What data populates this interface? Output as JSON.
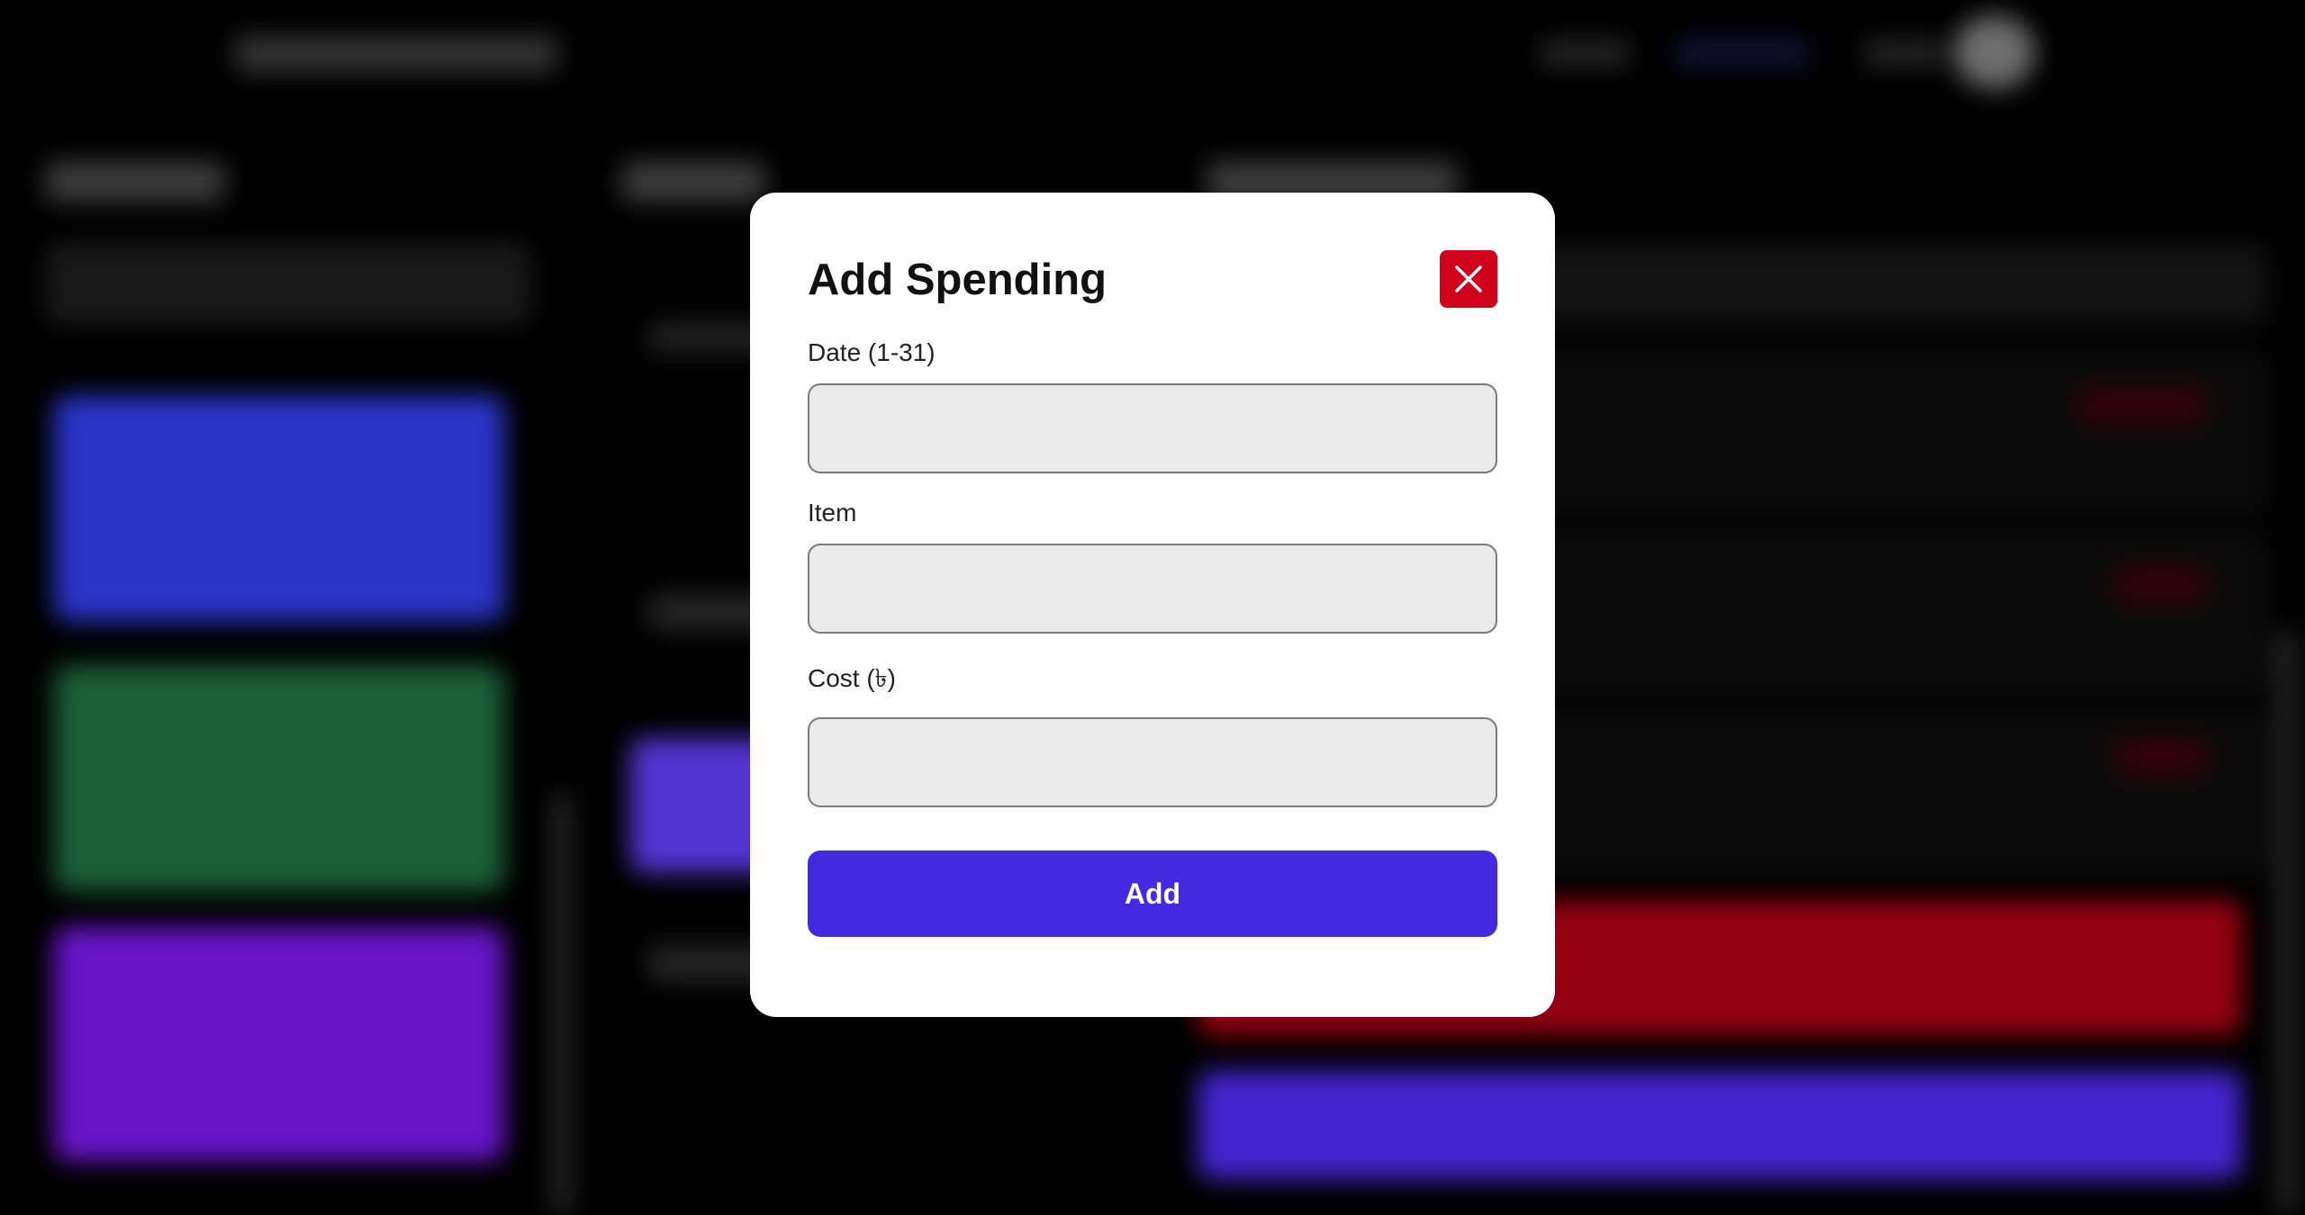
{
  "modal": {
    "title": "Add Spending",
    "close_icon": "close-icon",
    "fields": [
      {
        "label": "Date (1-31)",
        "value": "",
        "placeholder": ""
      },
      {
        "label": "Item",
        "value": "",
        "placeholder": ""
      },
      {
        "label": "Cost (৳)",
        "value": "",
        "placeholder": ""
      }
    ],
    "submit_label": "Add"
  },
  "colors": {
    "close_button": "#d0021b",
    "add_button": "#4529e0",
    "card_blue": "#2f3be0",
    "card_green": "#1f6b3f",
    "card_purple": "#7417e0",
    "banner_red": "#a30012",
    "banner_indigo": "#4a2ae6"
  }
}
